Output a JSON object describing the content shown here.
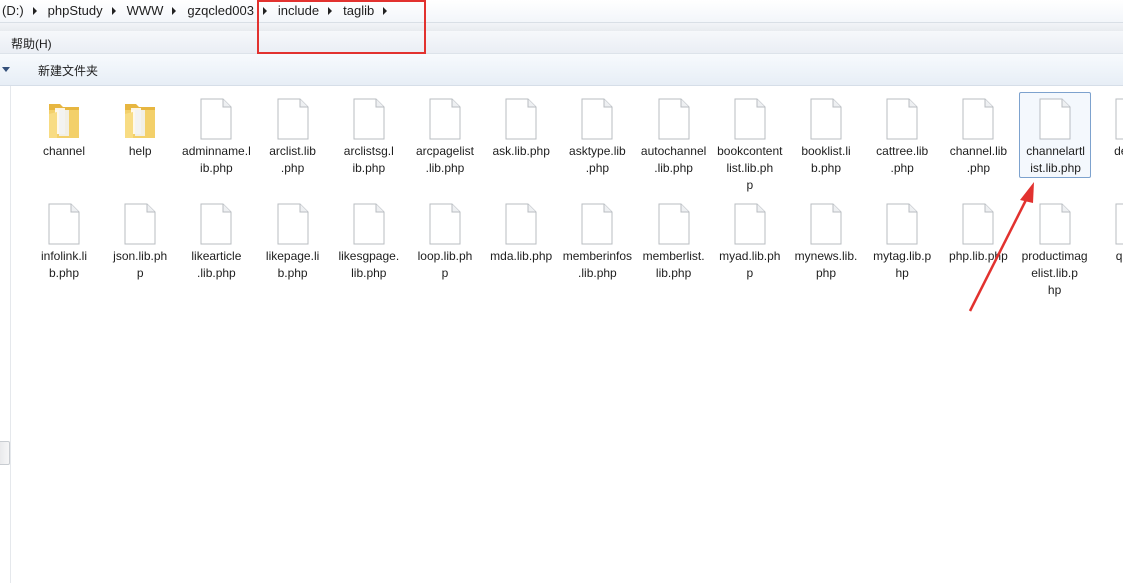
{
  "address_bar": {
    "segments": [
      "(D:)",
      "phpStudy",
      "WWW",
      "gzqcled003",
      "include",
      "taglib"
    ]
  },
  "menu": {
    "help_label": "帮助(H)"
  },
  "command_bar": {
    "new_folder_label": "新建文件夹"
  },
  "files_row1": [
    {
      "type": "folder",
      "label": "channel"
    },
    {
      "type": "folder",
      "label": "help"
    },
    {
      "type": "file",
      "label": "adminname.lib.php"
    },
    {
      "type": "file",
      "label": "arclist.lib.php"
    },
    {
      "type": "file",
      "label": "arclistsg.lib.php"
    },
    {
      "type": "file",
      "label": "arcpagelist.lib.php"
    },
    {
      "type": "file",
      "label": "ask.lib.php"
    },
    {
      "type": "file",
      "label": "asktype.lib.php"
    },
    {
      "type": "file",
      "label": "autochannel.lib.php"
    },
    {
      "type": "file",
      "label": "bookcontentlist.lib.php"
    },
    {
      "type": "file",
      "label": "booklist.lib.php"
    },
    {
      "type": "file",
      "label": "cattree.lib.php"
    },
    {
      "type": "file",
      "label": "channel.lib.php"
    },
    {
      "type": "file",
      "label": "channelartlist.lib.php",
      "selected": true
    },
    {
      "type": "file",
      "label": "demb."
    }
  ],
  "files_row2": [
    {
      "type": "file",
      "label": "infolink.lib.php"
    },
    {
      "type": "file",
      "label": "json.lib.php"
    },
    {
      "type": "file",
      "label": "likearticle.lib.php"
    },
    {
      "type": "file",
      "label": "likepage.lib.php"
    },
    {
      "type": "file",
      "label": "likesgpage.lib.php"
    },
    {
      "type": "file",
      "label": "loop.lib.php"
    },
    {
      "type": "file",
      "label": "mda.lib.php"
    },
    {
      "type": "file",
      "label": "memberinfos.lib.php"
    },
    {
      "type": "file",
      "label": "memberlist.lib.php"
    },
    {
      "type": "file",
      "label": "myad.lib.php"
    },
    {
      "type": "file",
      "label": "mynews.lib.php"
    },
    {
      "type": "file",
      "label": "mytag.lib.php"
    },
    {
      "type": "file",
      "label": "php.lib.php"
    },
    {
      "type": "file",
      "label": "productimagelist.lib.php"
    },
    {
      "type": "file",
      "label": "qrcop"
    }
  ],
  "colors": {
    "annotation": "#e2322f",
    "selection_border": "#7da2ce",
    "folder": "#f0c75a"
  }
}
